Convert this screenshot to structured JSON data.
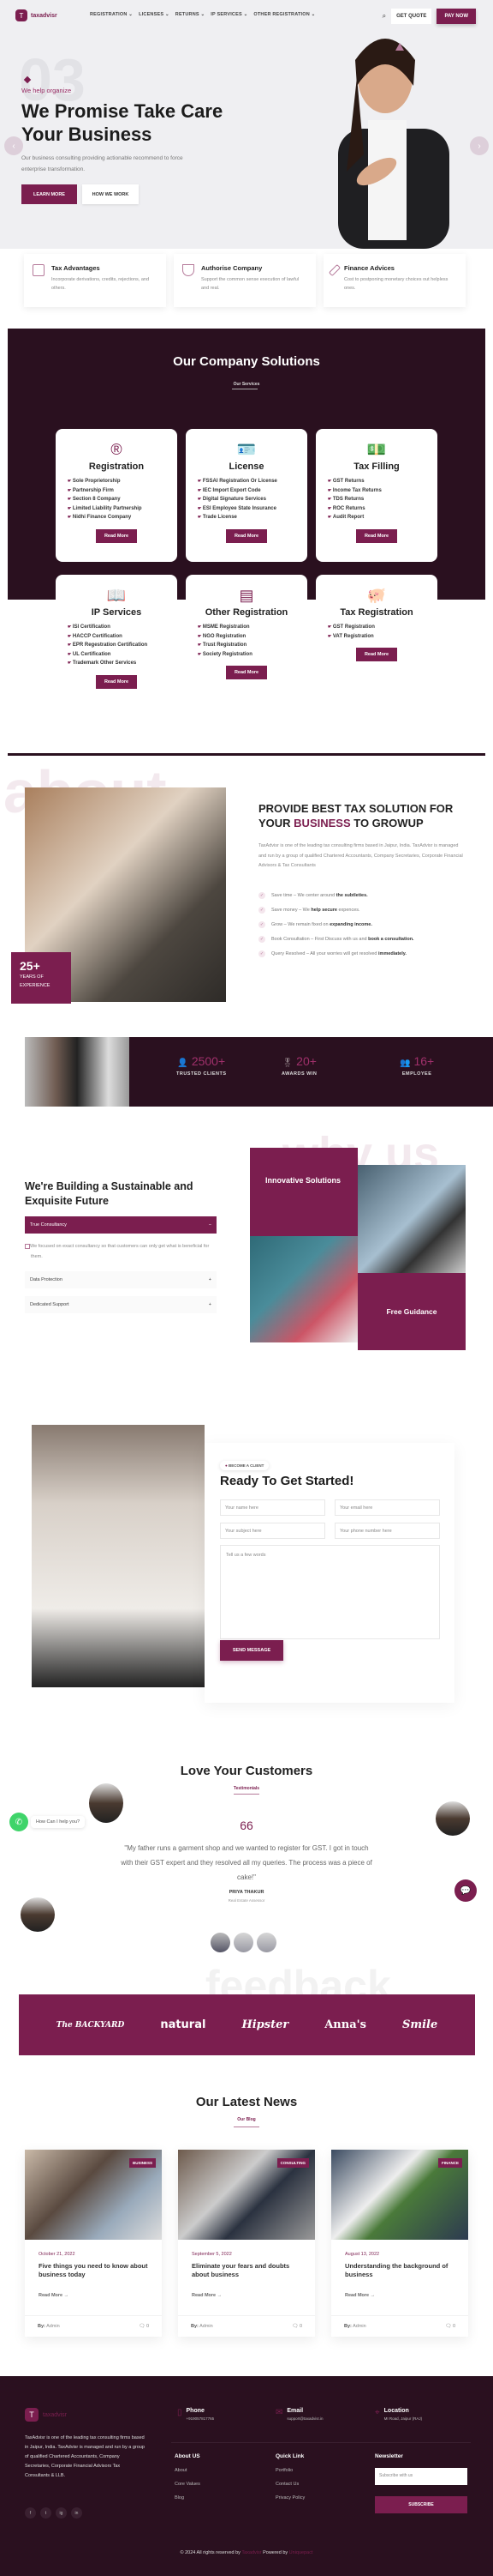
{
  "brand": {
    "name": "taxadvisr",
    "logo_letter": "T"
  },
  "nav": {
    "items": [
      "REGISTRATION",
      "LICENSES",
      "RETURNS",
      "IP SERVICES",
      "OTHER REGISTRATION"
    ],
    "get_quote": "GET QUOTE",
    "pay_now": "PAY NOW"
  },
  "hero": {
    "slide_number": "03",
    "kicker": "We help organize",
    "title": "We Promise Take Care Your Business",
    "subtitle": "Our business consulting providing actionable recommend to force enterprise transformation.",
    "learn_more": "LEARN MORE",
    "how_we_work": "HOW WE WORK"
  },
  "features": [
    {
      "title": "Tax Advantages",
      "text": "Incorporate derivations, credits, rejections, and others.",
      "icon": "chart-board-icon"
    },
    {
      "title": "Authorise Company",
      "text": "Support the common sense execution of lawful and real.",
      "icon": "shield-icon"
    },
    {
      "title": "Finance Advices",
      "text": "Cost to postponing monetary choices out helpless ones.",
      "icon": "pencil-icon"
    }
  ],
  "solutions": {
    "title": "Our Company Solutions",
    "subtitle": "Our Services",
    "cards": [
      {
        "title": "Registration",
        "icon": "®",
        "items": [
          "Sole Proprietorship",
          "Partnership Firm",
          "Section 8 Company",
          "Limited Liability Partnership",
          "Nidhi Finance Company"
        ],
        "button": "Read More"
      },
      {
        "title": "License",
        "icon": "🪪",
        "items": [
          "FSSAI Registration Or License",
          "IEC Import Export Code",
          "Digital Signature Services",
          "ESI Employee State Insurance",
          "Trade License"
        ],
        "button": "Read More"
      },
      {
        "title": "Tax Filling",
        "icon": "💵",
        "items": [
          "GST Returns",
          "Income Tax Returns",
          "TDS Returns",
          "ROC Returns",
          "Audit Report"
        ],
        "button": "Read More"
      },
      {
        "title": "IP Services",
        "icon": "📖",
        "items": [
          "ISI Certification",
          "HACCP Certification",
          "EPR Regestration Certification",
          "UL Certification",
          "Trademark Other Services"
        ],
        "button": "Read More"
      },
      {
        "title": "Other Registration",
        "icon": "▤",
        "items": [
          "MSME Registration",
          "NGO Registration",
          "Trust Registration",
          "Society Registration"
        ],
        "button": "Read More"
      },
      {
        "title": "Tax Registration",
        "icon": "🐖",
        "items": [
          "GST Registration",
          "VAT Registration"
        ],
        "button": "Read More"
      }
    ]
  },
  "about": {
    "bg_word": "about",
    "title_pre": "PROVIDE BEST TAX SOLUTION FOR YOUR ",
    "title_highlight": "BUSINESS",
    "title_post": " TO GROWUP",
    "paragraph": "TaxAdvisr is one of the leading tax consulting firms based in Jaipur, India. TaxAdvisr is managed and run by a group of qualified Chartered Accountants, Company Secretaries, Corporate Financial Advisors & Tax Consultants",
    "experience_number": "25+",
    "experience_label": "YEARS OF EXPERIENCE",
    "checks": [
      {
        "text": "Save time – We center around ",
        "bold": "the subtleties."
      },
      {
        "text": "Save money – We ",
        "bold": "help secure",
        "after": " expences."
      },
      {
        "text": "Grow – We remain fixed on ",
        "bold": "expanding income."
      },
      {
        "text": "Book Consultation – First Discuss with us and ",
        "bold": "book a consultation."
      },
      {
        "text": "Query Resolved – All your worries will get resolved ",
        "bold": "immediately."
      }
    ]
  },
  "stats": [
    {
      "value": "2500+",
      "label": "TRUSTED CLIENTS",
      "icon": "user-shield-icon"
    },
    {
      "value": "20+",
      "label": "AWARDS WIN",
      "icon": "award-icon"
    },
    {
      "value": "16+",
      "label": "EMPLOYEE",
      "icon": "users-icon"
    }
  ],
  "why": {
    "bg_word": "why us",
    "title": "We're Building a Sustainable and Exquisite Future",
    "accordion": [
      {
        "label": "True Consultancy",
        "open": true,
        "text": "We focused on exact consultancy so that customers can only get what is beneficial for them."
      },
      {
        "label": "Data Protection",
        "open": false
      },
      {
        "label": "Dedicated Support",
        "open": false
      }
    ],
    "tile_innovative": "Innovative Solutions",
    "tile_guidance": "Free Guidance"
  },
  "contact": {
    "badge": "BECOME A CLIENT",
    "title": "Ready To Get Started!",
    "name_placeholder": "Your name here",
    "email_placeholder": "Your email here",
    "subject_placeholder": "Your subject here",
    "phone_placeholder": "Your phone number here",
    "message_placeholder": "Tell us a few words",
    "send": "SEND MESSAGE"
  },
  "testimonials": {
    "title": "Love Your Customers",
    "subtitle": "Testimonials",
    "quote_mark": "66",
    "quote": "\"My father runs a garment shop and we wanted to register for GST. I got in touch with their GST expert and they resolved all my queries. The process was a piece of cake!\"",
    "name": "PRIYA THAKUR",
    "role": "Real Estate Assessor",
    "bg_word": "feedback"
  },
  "widgets": {
    "whatsapp_tip": "How Can I help you?"
  },
  "brands": [
    "The BACKYARD",
    "natural",
    "Hipster",
    "Anna's",
    "Smile"
  ],
  "news": {
    "title": "Our Latest News",
    "subtitle": "Our Blog",
    "posts": [
      {
        "tag": "BUSINESS",
        "date": "October 21, 2022",
        "title": "Five things you need to know about business today",
        "more": "Read More →",
        "by_label": "By:",
        "author": "Admin",
        "comments": "0"
      },
      {
        "tag": "CONSULTING",
        "date": "September 5, 2022",
        "title": "Eliminate your fears and doubts about business",
        "more": "Read More →",
        "by_label": "By:",
        "author": "Admin",
        "comments": "0"
      },
      {
        "tag": "FINANCE",
        "date": "August 13, 2022",
        "title": "Understanding the background of business",
        "more": "Read More →",
        "by_label": "By:",
        "author": "Admin",
        "comments": "0"
      }
    ]
  },
  "footer": {
    "about": "TaxAdvisr is one of the leading tax consulting firms based in Jaipur, India. TaxAdvisr is managed and run by a group of qualified Chartered Accountants, Company Secretaries, Corporate Financial Advisors Tax Consultants & LLB.",
    "phone_label": "Phone",
    "phone": "+919057817765",
    "email_label": "Email",
    "email": "support@taxadvisr.in",
    "location_label": "Location",
    "location": "MI Road, Jaipur (RAJ)",
    "about_heading": "About US",
    "about_links": [
      "About",
      "Core Values",
      "Blog"
    ],
    "quick_heading": "Quick Link",
    "quick_links": [
      "Portfolio",
      "Contact Us",
      "Privacy Policy"
    ],
    "newsletter_heading": "Newsletter",
    "subscribe_placeholder": "Subscribe with us",
    "subscribe": "SUBSCRIBE",
    "socials": [
      "f",
      "t",
      "ig",
      "in"
    ],
    "copy_pre": "© 2024 All rights reserved by ",
    "copy_brand": "Taxadvisr",
    "copy_mid": " Powered by ",
    "copy_powered": "Uniquepact"
  },
  "colors": {
    "brand": "#7b1e4f",
    "dark": "#2a101f"
  }
}
